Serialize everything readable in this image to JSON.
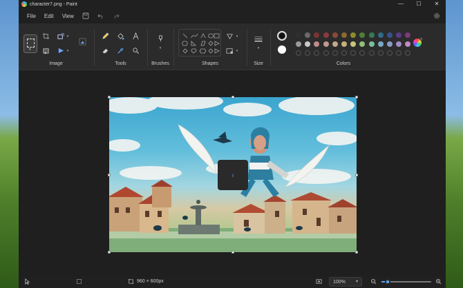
{
  "window": {
    "title": "character7.png - Paint",
    "controls": {
      "minimize": "—",
      "maximize": "☐",
      "close": "✕"
    }
  },
  "menu": {
    "file": "File",
    "edit": "Edit",
    "view": "View"
  },
  "ribbon": {
    "groups": {
      "image": "Image",
      "tools": "Tools",
      "brushes": "Brushes",
      "shapes": "Shapes",
      "size": "Size",
      "colors": "Colors"
    },
    "palette": {
      "primary": "#101010",
      "secondary": "#ffffff",
      "row1": [
        "#2f2f2f",
        "#6a6a6a",
        "#7a3434",
        "#8a3a3a",
        "#8a4a3a",
        "#8c6a2e",
        "#8c8c2e",
        "#4f7f34",
        "#357a55",
        "#356a8a",
        "#3b4f8a",
        "#5a3b8a",
        "#7a3b7a"
      ],
      "row2": [
        "#9a9a9a",
        "#c8c8c8",
        "#c08a8a",
        "#c09a8a",
        "#c0a88a",
        "#c6b07a",
        "#c6c67a",
        "#8fbf7a",
        "#7abfa0",
        "#7aa8c6",
        "#8a9ac6",
        "#a08ac6",
        "#c08ac0"
      ]
    }
  },
  "canvas": {
    "image_name": "character7.png",
    "loading_glyph": "ı"
  },
  "status": {
    "dimensions": "960 × 600px",
    "zoom": "100%",
    "zoom_fraction": 0.12
  }
}
